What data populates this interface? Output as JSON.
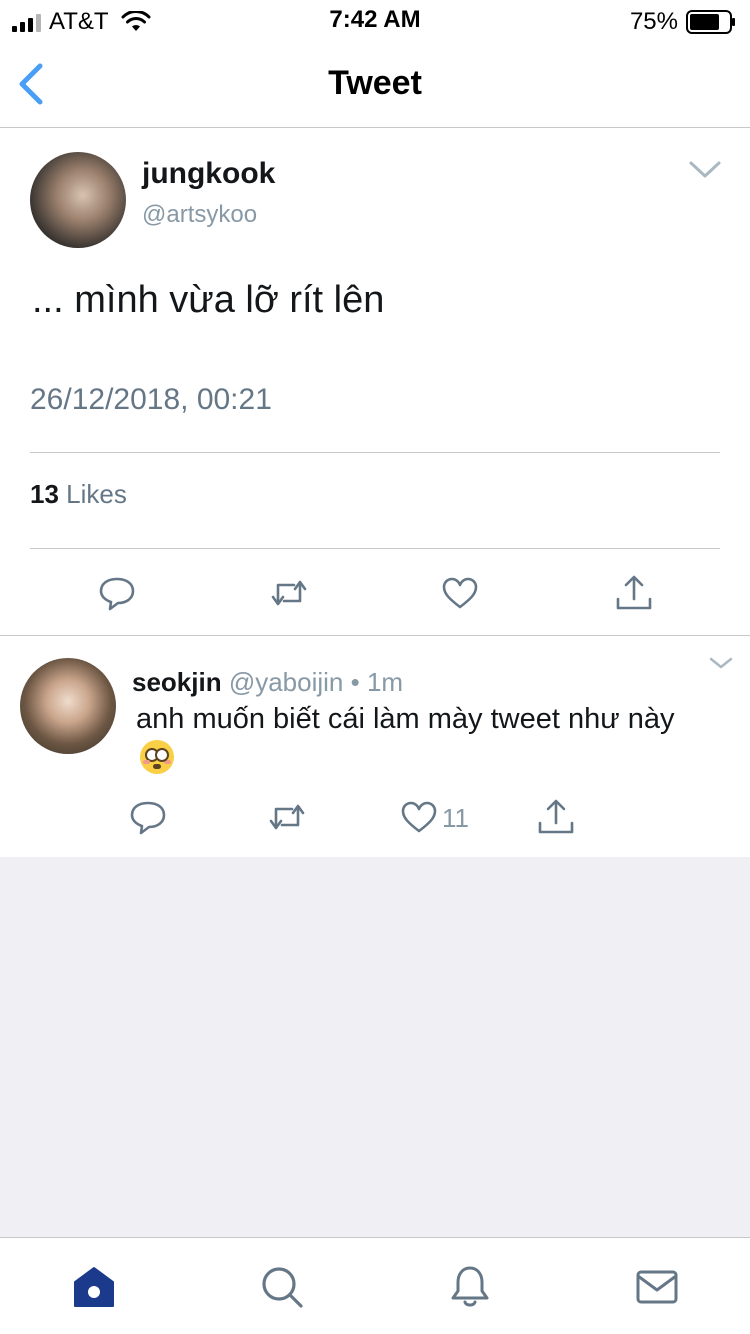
{
  "status_bar": {
    "carrier": "AT&T",
    "time": "7:42 AM",
    "battery_percent": "75%",
    "battery_level": 0.75,
    "signal_bars": 3
  },
  "nav": {
    "title": "Tweet",
    "back_icon": "chevron-left-icon"
  },
  "tweet": {
    "display_name": "jungkook",
    "handle": "@artsykoo",
    "text": "... mình vừa lỡ rít lên",
    "timestamp": "26/12/2018, 00:21",
    "likes_count": "13",
    "likes_label": "Likes",
    "actions": [
      "reply-icon",
      "retweet-icon",
      "like-icon",
      "share-icon"
    ]
  },
  "reply": {
    "display_name": "seokjin",
    "handle": "@yaboijin",
    "separator": "•",
    "age": "1m",
    "text": "anh muốn biết cái làm mày tweet như này",
    "emoji_icon": "flushed-face-icon",
    "like_count": "11"
  },
  "tabbar": {
    "items": [
      "home-icon",
      "search-icon",
      "notifications-icon",
      "messages-icon"
    ],
    "active": "home-icon"
  },
  "colors": {
    "accent": "#1da1f2",
    "active_tab": "#1c3a8c",
    "icon": "#657786",
    "background_empty": "#efeff4"
  }
}
